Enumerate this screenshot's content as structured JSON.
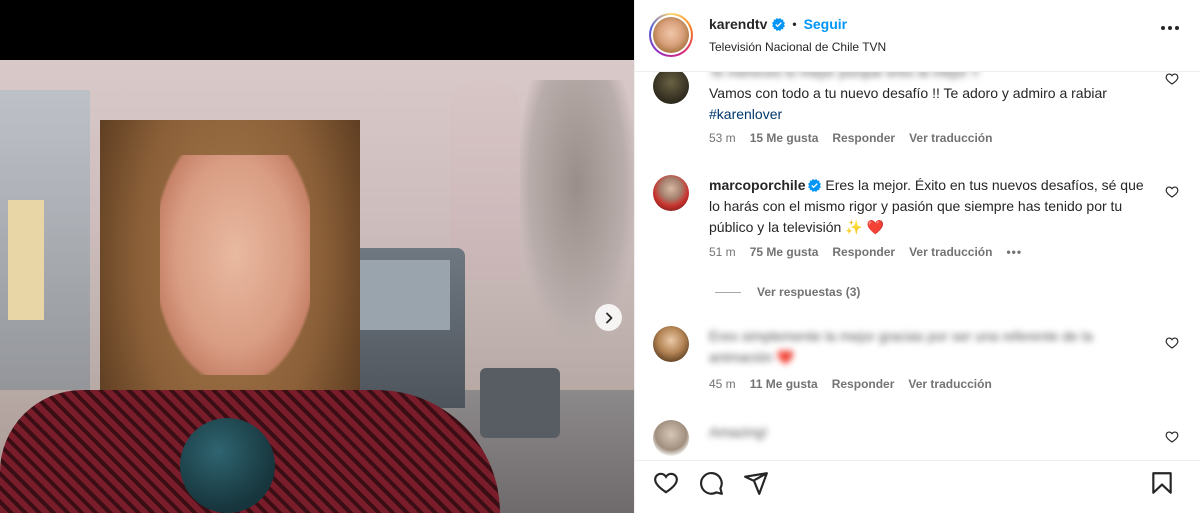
{
  "post": {
    "username": "karendtv",
    "follow_label": "Seguir",
    "separator": "•",
    "subtitle": "Televisión Nacional de Chile TVN"
  },
  "comments": [
    {
      "username": "",
      "text_partial_top": "Te mereces lo mejor porque eres la mejor !!",
      "text": "Vamos con todo a tu nuevo desafío !! Te adoro y admiro a rabiar ",
      "hashtag": "#karenlover",
      "time": "53 m",
      "likes": "15 Me gusta",
      "reply": "Responder",
      "translate": "Ver traducción"
    },
    {
      "username": "marcoporchile",
      "text": "Eres la mejor. Éxito en tus nuevos desafíos, sé que lo harás con el mismo rigor y pasión que siempre has tenido por tu público y la televisión ✨ ❤️",
      "time": "51 m",
      "likes": "75 Me gusta",
      "reply": "Responder",
      "translate": "Ver traducción",
      "more": "•••",
      "view_replies": "Ver respuestas (3)"
    },
    {
      "username": "",
      "text": "Eres simplemente la mejor gracias por ser una referente de la animación ❤️",
      "time": "45 m",
      "likes": "11 Me gusta",
      "reply": "Responder",
      "translate": "Ver traducción"
    },
    {
      "username": "",
      "text": "Amazing!"
    }
  ],
  "colors": {
    "link_blue": "#0095f6",
    "hashtag": "#00376b",
    "muted": "#737373",
    "text": "#262626",
    "verified": "#0095f6"
  },
  "icons": [
    "chevron-right-icon",
    "verified-icon",
    "more-icon",
    "heart-icon",
    "comment-icon",
    "share-icon",
    "bookmark-icon"
  ]
}
